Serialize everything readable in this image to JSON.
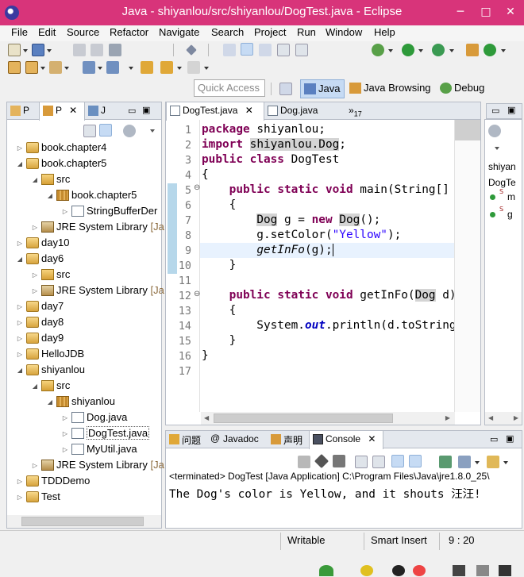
{
  "window": {
    "title": "Java - shiyanlou/src/shiyanlou/DogTest.java - Eclipse",
    "minimize": "─",
    "maximize": "□",
    "close": "✕"
  },
  "menu": [
    "File",
    "Edit",
    "Source",
    "Refactor",
    "Navigate",
    "Search",
    "Project",
    "Run",
    "Window",
    "Help"
  ],
  "quick_access": {
    "placeholder": "Quick Access"
  },
  "perspectives": [
    {
      "label": "Java",
      "active": true
    },
    {
      "label": "Java Browsing",
      "active": false
    },
    {
      "label": "Debug",
      "active": false
    }
  ],
  "left_tabs": [
    {
      "label": "P"
    },
    {
      "label": "P"
    },
    {
      "label": "J"
    }
  ],
  "tree": [
    {
      "label": "book.chapter4",
      "icon": "project-icon",
      "indent": 0,
      "twisty": "▷"
    },
    {
      "label": "book.chapter5",
      "icon": "project-icon",
      "indent": 0,
      "twisty": "◢"
    },
    {
      "label": "src",
      "icon": "source-folder-icon",
      "indent": 1,
      "twisty": "◢"
    },
    {
      "label": "book.chapter5",
      "icon": "package-icon",
      "indent": 2,
      "twisty": "◢"
    },
    {
      "label": "StringBufferDer",
      "icon": "java-file-icon",
      "indent": 3,
      "twisty": "▷"
    },
    {
      "label": "JRE System Library",
      "suffix": " [Ja",
      "icon": "library-icon",
      "indent": 1,
      "twisty": "▷"
    },
    {
      "label": "day10",
      "icon": "project-icon",
      "indent": 0,
      "twisty": "▷"
    },
    {
      "label": "day6",
      "icon": "project-icon",
      "indent": 0,
      "twisty": "◢"
    },
    {
      "label": "src",
      "icon": "source-folder-icon",
      "indent": 1,
      "twisty": "▷"
    },
    {
      "label": "JRE System Library",
      "suffix": " [Ja",
      "icon": "library-icon",
      "indent": 1,
      "twisty": "▷"
    },
    {
      "label": "day7",
      "icon": "project-icon",
      "indent": 0,
      "twisty": "▷"
    },
    {
      "label": "day8",
      "icon": "project-icon",
      "indent": 0,
      "twisty": "▷"
    },
    {
      "label": "day9",
      "icon": "project-icon",
      "indent": 0,
      "twisty": "▷"
    },
    {
      "label": "HelloJDB",
      "icon": "project-icon",
      "indent": 0,
      "twisty": "▷"
    },
    {
      "label": "shiyanlou",
      "icon": "project-icon",
      "indent": 0,
      "twisty": "◢"
    },
    {
      "label": "src",
      "icon": "source-folder-icon",
      "indent": 1,
      "twisty": "◢"
    },
    {
      "label": "shiyanlou",
      "icon": "package-icon",
      "indent": 2,
      "twisty": "◢"
    },
    {
      "label": "Dog.java",
      "icon": "java-file-icon",
      "indent": 3,
      "twisty": "▷"
    },
    {
      "label": "DogTest.java",
      "icon": "java-file-icon",
      "indent": 3,
      "twisty": "▷",
      "selected": true
    },
    {
      "label": "MyUtil.java",
      "icon": "java-file-icon",
      "indent": 3,
      "twisty": "▷"
    },
    {
      "label": "JRE System Library",
      "suffix": " [Ja",
      "icon": "library-icon",
      "indent": 1,
      "twisty": "▷"
    },
    {
      "label": "TDDDemo",
      "icon": "project-icon",
      "indent": 0,
      "twisty": "▷"
    },
    {
      "label": "Test",
      "icon": "project-icon",
      "indent": 0,
      "twisty": "▷"
    }
  ],
  "editor": {
    "tabs": [
      {
        "label": "DogTest.java",
        "active": true,
        "close": "✕"
      },
      {
        "label": "Dog.java",
        "active": false
      },
      {
        "label": "»",
        "sub": "17"
      }
    ],
    "line_numbers": [
      "1",
      "2",
      "3",
      "4",
      "5",
      "6",
      "7",
      "8",
      "9",
      "10",
      "11",
      "12",
      "13",
      "14",
      "15",
      "16",
      "17"
    ],
    "fold_markers": {
      "5": "⊖",
      "12": "⊖"
    },
    "cursor": "9 : 20"
  },
  "outline": {
    "items": [
      "shiyan",
      "DogTe",
      "m",
      "g"
    ]
  },
  "bottom_tabs": [
    {
      "label": "问题"
    },
    {
      "label": "Javadoc"
    },
    {
      "label": "声明"
    },
    {
      "label": "Console",
      "active": true,
      "close": "✕"
    }
  ],
  "console": {
    "header": "<terminated> DogTest [Java Application] C:\\Program Files\\Java\\jre1.8.0_25\\",
    "output": "The Dog's color is Yellow, and it shouts 汪汪!"
  },
  "status": {
    "writable": "Writable",
    "insert_mode": "Smart Insert",
    "position": "9 : 20"
  }
}
